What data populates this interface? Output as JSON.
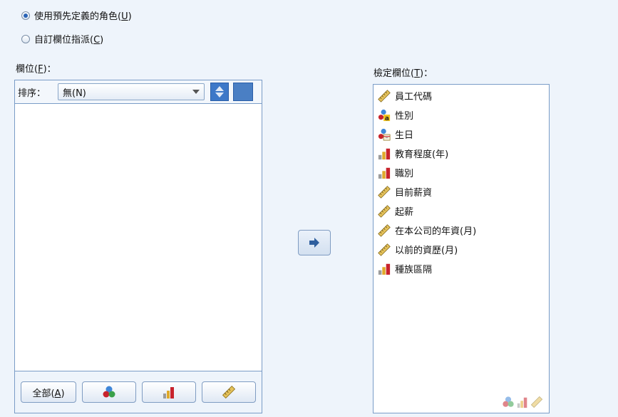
{
  "radios": [
    {
      "label": "使用預先定義的角色",
      "accel": "U",
      "selected": true
    },
    {
      "label": "自訂欄位指派",
      "accel": "C",
      "selected": false
    }
  ],
  "fields": {
    "label": "欄位",
    "accel": "F",
    "sort_label": "排序：",
    "sort_value": "無(N)",
    "items": []
  },
  "buttons": {
    "all_label": "全部",
    "all_accel": "A"
  },
  "target": {
    "label": "檢定欄位",
    "accel": "T",
    "items": [
      {
        "name": "員工代碼",
        "icon": "scale-ruler-icon"
      },
      {
        "name": "性別",
        "icon": "nominal-string-icon"
      },
      {
        "name": "生日",
        "icon": "nominal-date-icon"
      },
      {
        "name": "教育程度(年)",
        "icon": "ordinal-bar-icon"
      },
      {
        "name": "職別",
        "icon": "ordinal-bar-icon"
      },
      {
        "name": "目前薪資",
        "icon": "scale-ruler-icon"
      },
      {
        "name": "起薪",
        "icon": "scale-ruler-icon"
      },
      {
        "name": "在本公司的年資(月)",
        "icon": "scale-ruler-icon"
      },
      {
        "name": "以前的資歷(月)",
        "icon": "scale-ruler-icon"
      },
      {
        "name": "種族區隔",
        "icon": "ordinal-bar-icon"
      }
    ]
  },
  "colors": {
    "background": "#eef4fb",
    "border": "#7a9cc7",
    "ruler": "#d9b23a",
    "bar_red": "#c8232c",
    "nominal_blue": "#3f86d8"
  }
}
